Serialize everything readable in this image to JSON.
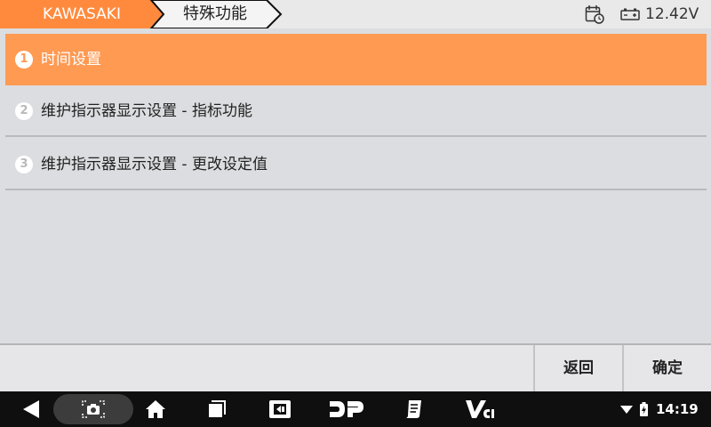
{
  "header": {
    "brand": "KAWASAKI",
    "page_title": "特殊功能",
    "voltage": "12.42V",
    "accent_color": "#ff8a3d"
  },
  "menu": {
    "items": [
      {
        "num": "1",
        "label": "时间设置",
        "selected": true
      },
      {
        "num": "2",
        "label": "维护指示器显示设置 - 指标功能",
        "selected": false
      },
      {
        "num": "3",
        "label": "维护指示器显示设置 - 更改设定值",
        "selected": false
      }
    ]
  },
  "buttons": {
    "back_label": "返回",
    "ok_label": "确定"
  },
  "statusbar": {
    "time": "14:19",
    "icons": [
      "wifi-icon",
      "battery-icon"
    ]
  },
  "navbar": {
    "icons": [
      "back-icon",
      "screenshot-icon",
      "home-icon",
      "recent-apps-icon",
      "app-icon",
      "dp-icon",
      "notes-icon",
      "vci-icon"
    ]
  }
}
